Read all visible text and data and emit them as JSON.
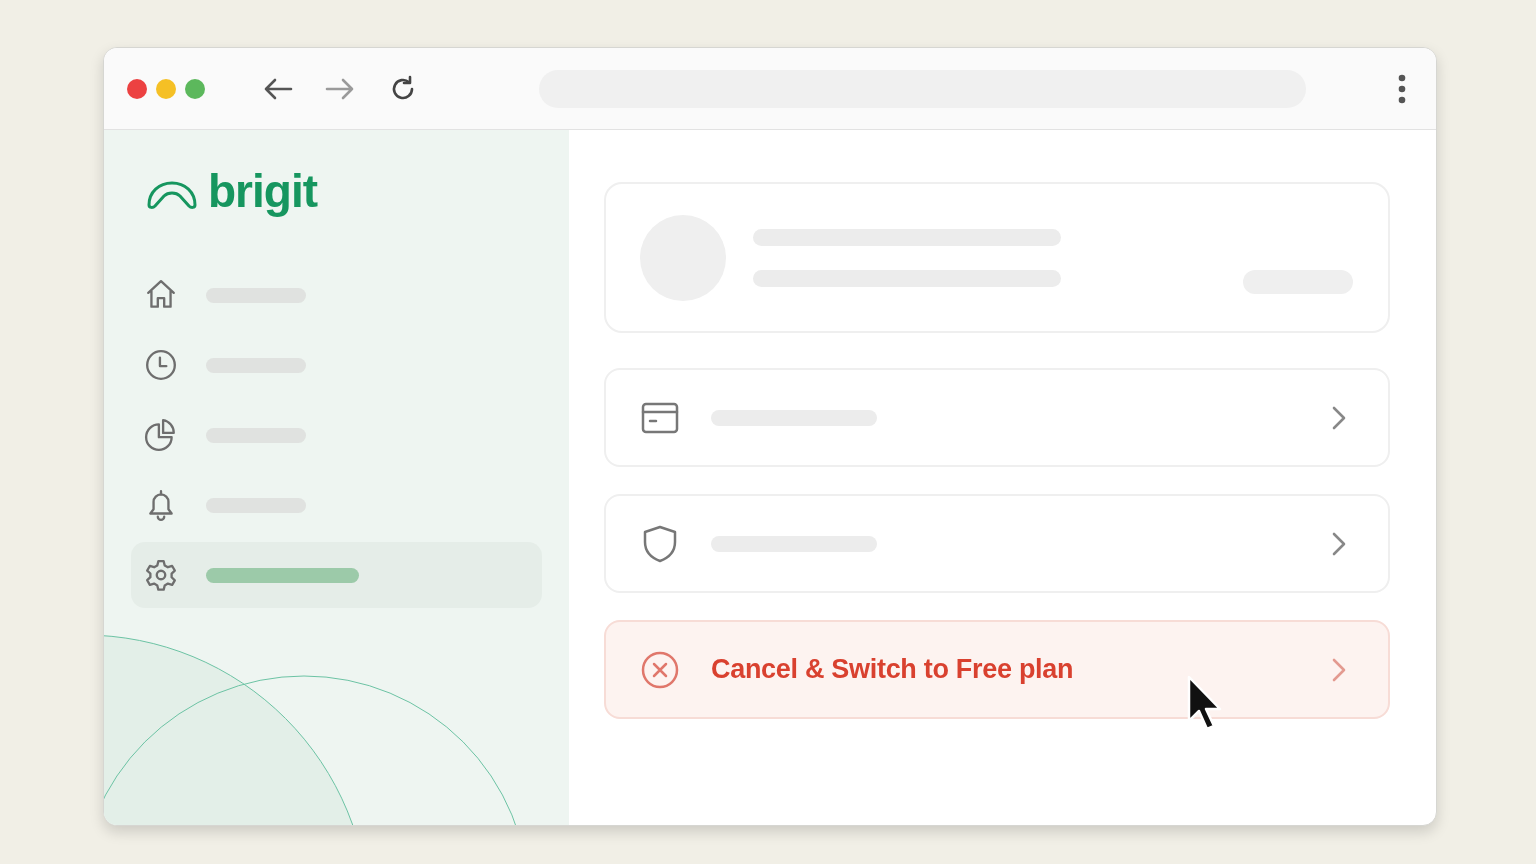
{
  "logo": {
    "text": "brigit"
  },
  "sidebar": {
    "items": [
      {
        "selected": false
      },
      {
        "selected": false
      },
      {
        "selected": false
      },
      {
        "selected": false
      },
      {
        "selected": true
      }
    ]
  },
  "rows": [
    {
      "kind": "placeholder"
    },
    {
      "kind": "placeholder"
    },
    {
      "kind": "danger",
      "label": "Cancel & Switch to Free plan"
    }
  ]
}
